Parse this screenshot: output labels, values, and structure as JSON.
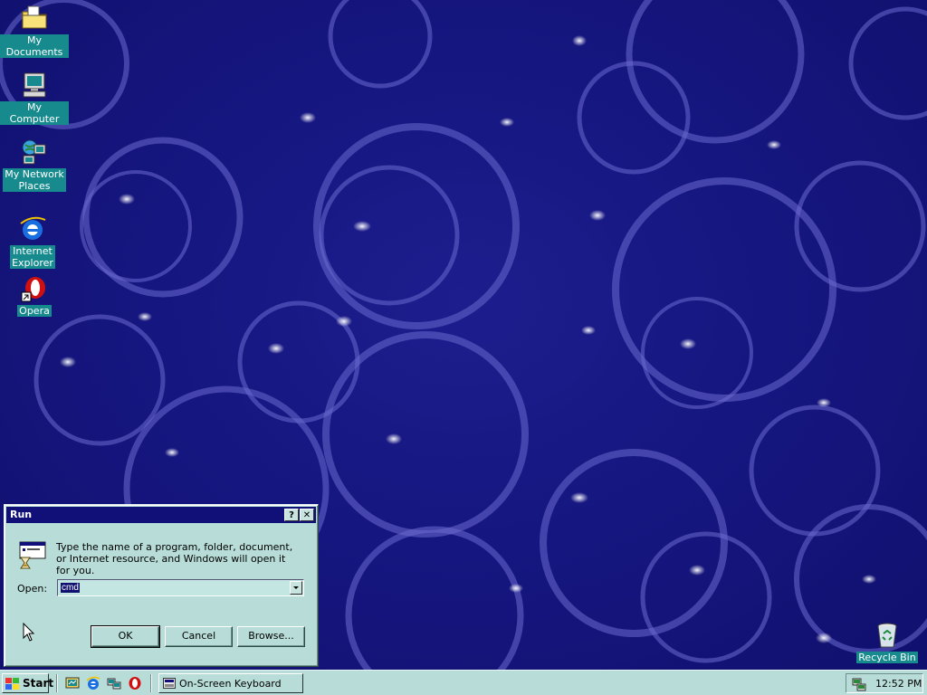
{
  "desktop": {
    "icons": [
      {
        "label": "My Documents",
        "icon": "folder-icon"
      },
      {
        "label": "My Computer",
        "icon": "computer-icon"
      },
      {
        "label_line1": "My Network",
        "label_line2": "Places",
        "icon": "network-icon"
      },
      {
        "label_line1": "Internet",
        "label_line2": "Explorer",
        "icon": "ie-icon"
      },
      {
        "label": "Opera",
        "icon": "opera-icon"
      },
      {
        "label": "Recycle Bin",
        "icon": "recycle-bin-icon"
      }
    ]
  },
  "run_dialog": {
    "title": "Run",
    "help_button": "?",
    "close_button": "✕",
    "description": "Type the name of a program, folder, document, or Internet resource, and Windows will open it for you.",
    "open_label": "Open:",
    "open_value": "cmd",
    "buttons": {
      "ok": "OK",
      "cancel": "Cancel",
      "browse": "Browse..."
    }
  },
  "taskbar": {
    "start_label": "Start",
    "quick_launch": [
      "show-desktop-icon",
      "ie-icon",
      "network-tray-icon",
      "opera-icon"
    ],
    "tasks": [
      {
        "label": "On-Screen Keyboard",
        "icon": "keyboard-icon"
      }
    ],
    "clock": "12:52 PM"
  },
  "colors": {
    "desktop_bg": "#15157e",
    "title_bar": "#101078",
    "window_face": "#b8ddd8",
    "icon_label_bg": "#178a8e"
  }
}
